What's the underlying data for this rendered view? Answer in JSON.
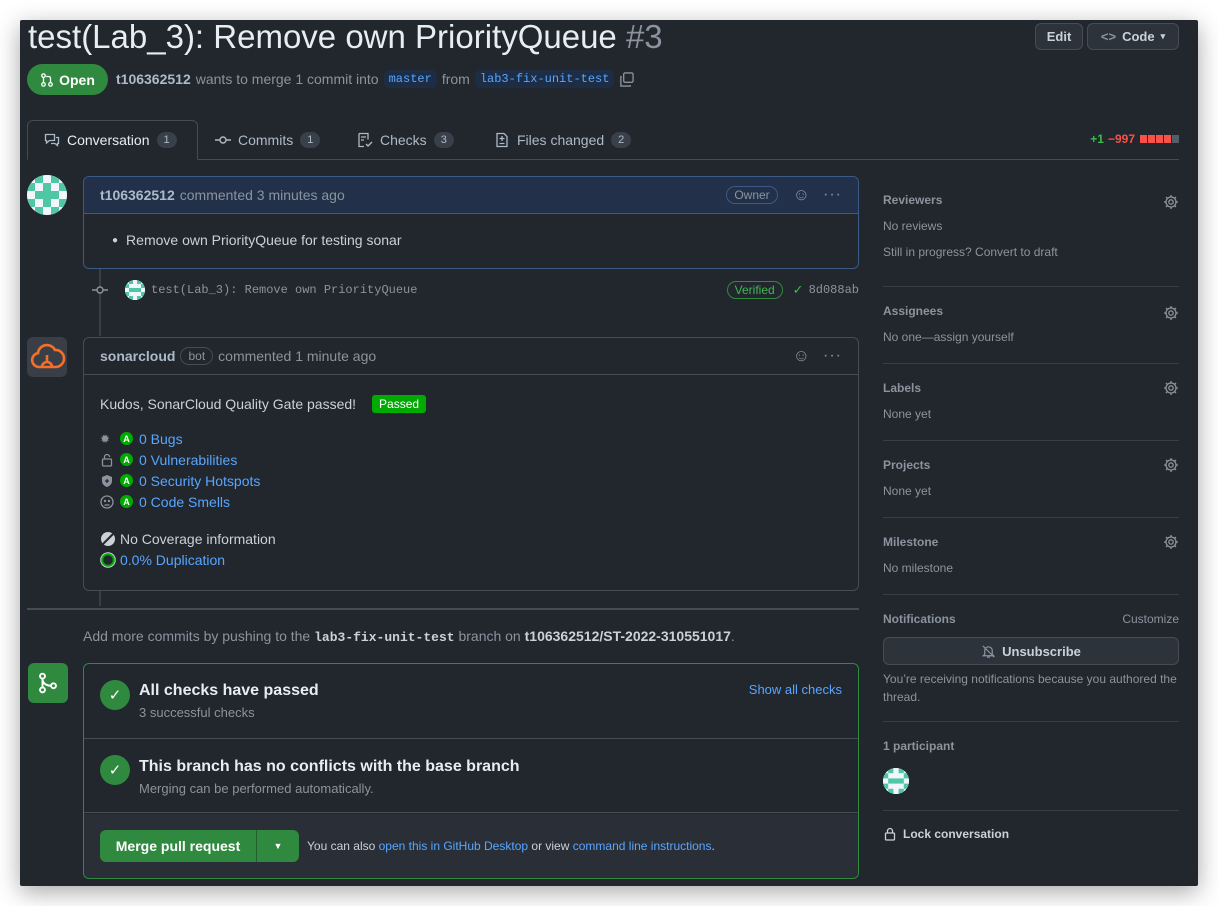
{
  "pr": {
    "title": "test(Lab_3): Remove own PriorityQueue",
    "number": "#3",
    "state": "Open",
    "author": "t106362512",
    "merge_text": "wants to merge 1 commit into",
    "base_branch": "master",
    "from_text": "from",
    "head_branch": "lab3-fix-unit-test"
  },
  "header_buttons": {
    "edit": "Edit",
    "code": "Code"
  },
  "tabs": [
    {
      "label": "Conversation",
      "count": "1"
    },
    {
      "label": "Commits",
      "count": "1"
    },
    {
      "label": "Checks",
      "count": "3"
    },
    {
      "label": "Files changed",
      "count": "2"
    }
  ],
  "diffstat": {
    "additions": "+1",
    "deletions": "−997"
  },
  "comment1": {
    "author": "t106362512",
    "time": "commented 3 minutes ago",
    "badge": "Owner",
    "body": "Remove own PriorityQueue for testing sonar"
  },
  "commit": {
    "message": "test(Lab_3): Remove own PriorityQueue",
    "verified": "Verified",
    "sha": "8d088ab"
  },
  "comment2": {
    "author": "sonarcloud",
    "bot": "bot",
    "time": "commented 1 minute ago",
    "headline": "Kudos, SonarCloud Quality Gate passed!",
    "passed": "Passed",
    "metrics": [
      {
        "icon": "bug-icon",
        "grade": "A",
        "label": "0 Bugs"
      },
      {
        "icon": "lock-icon",
        "grade": "A",
        "label": "0 Vulnerabilities"
      },
      {
        "icon": "shield-icon",
        "grade": "A",
        "label": "0 Security Hotspots"
      },
      {
        "icon": "smell-icon",
        "grade": "A",
        "label": "0 Code Smells"
      }
    ],
    "coverage": "No Coverage information",
    "duplication": "0.0% Duplication"
  },
  "push_hint": {
    "prefix": "Add more commits by pushing to the",
    "branch": "lab3-fix-unit-test",
    "middle": "branch on",
    "repo": "t106362512/ST-2022-310551017",
    "suffix": "."
  },
  "merge_box": {
    "checks_title": "All checks have passed",
    "checks_sub": "3 successful checks",
    "show_all": "Show all checks",
    "conflicts_title": "This branch has no conflicts with the base branch",
    "conflicts_sub": "Merging can be performed automatically.",
    "merge_button": "Merge pull request",
    "also_text": "You can also",
    "desktop_link": "open this in GitHub Desktop",
    "or_view": "or view",
    "cli_link": "command line instructions",
    "end": "."
  },
  "sidebar": {
    "reviewers": {
      "title": "Reviewers",
      "line1": "No reviews",
      "line2": "Still in progress? Convert to draft"
    },
    "assignees": {
      "title": "Assignees",
      "value": "No one—assign yourself"
    },
    "labels": {
      "title": "Labels",
      "value": "None yet"
    },
    "projects": {
      "title": "Projects",
      "value": "None yet"
    },
    "milestone": {
      "title": "Milestone",
      "value": "No milestone"
    },
    "notifications": {
      "title": "Notifications",
      "customize": "Customize",
      "button": "Unsubscribe",
      "note": "You’re receiving notifications because you authored the thread."
    },
    "participants": {
      "title": "1 participant"
    },
    "lock": "Lock conversation"
  },
  "colors": {
    "background": "#22262d",
    "accent_link": "#58a6ff",
    "success": "#2f8a3f",
    "deletions": "#f85149",
    "additions": "#3fb950"
  }
}
